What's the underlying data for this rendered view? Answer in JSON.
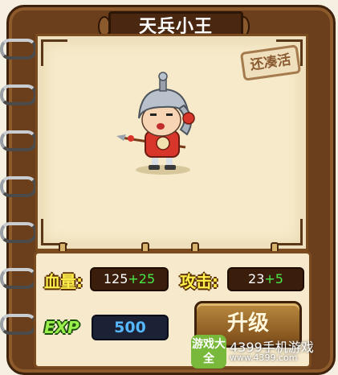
{
  "card": {
    "title": "天兵小王",
    "stamp_label": "还凑活"
  },
  "stats": {
    "hp_label": "血量:",
    "hp_base": "125",
    "hp_bonus": "+25",
    "attack_label": "攻击:",
    "attack_base": "23",
    "attack_bonus": "+5",
    "exp_label": "EXP",
    "exp_value": "500"
  },
  "actions": {
    "upgrade_label": "升级"
  },
  "watermark": {
    "logo_text": "游戏大全",
    "line1": "4399手机游戏",
    "line2": "www.4399.com"
  },
  "colors": {
    "frame": "#6b3f1c",
    "parchment": "#f6eacb",
    "label_yellow": "#fff04a",
    "bonus_green": "#48e848",
    "exp_blue": "#55b8ff"
  }
}
